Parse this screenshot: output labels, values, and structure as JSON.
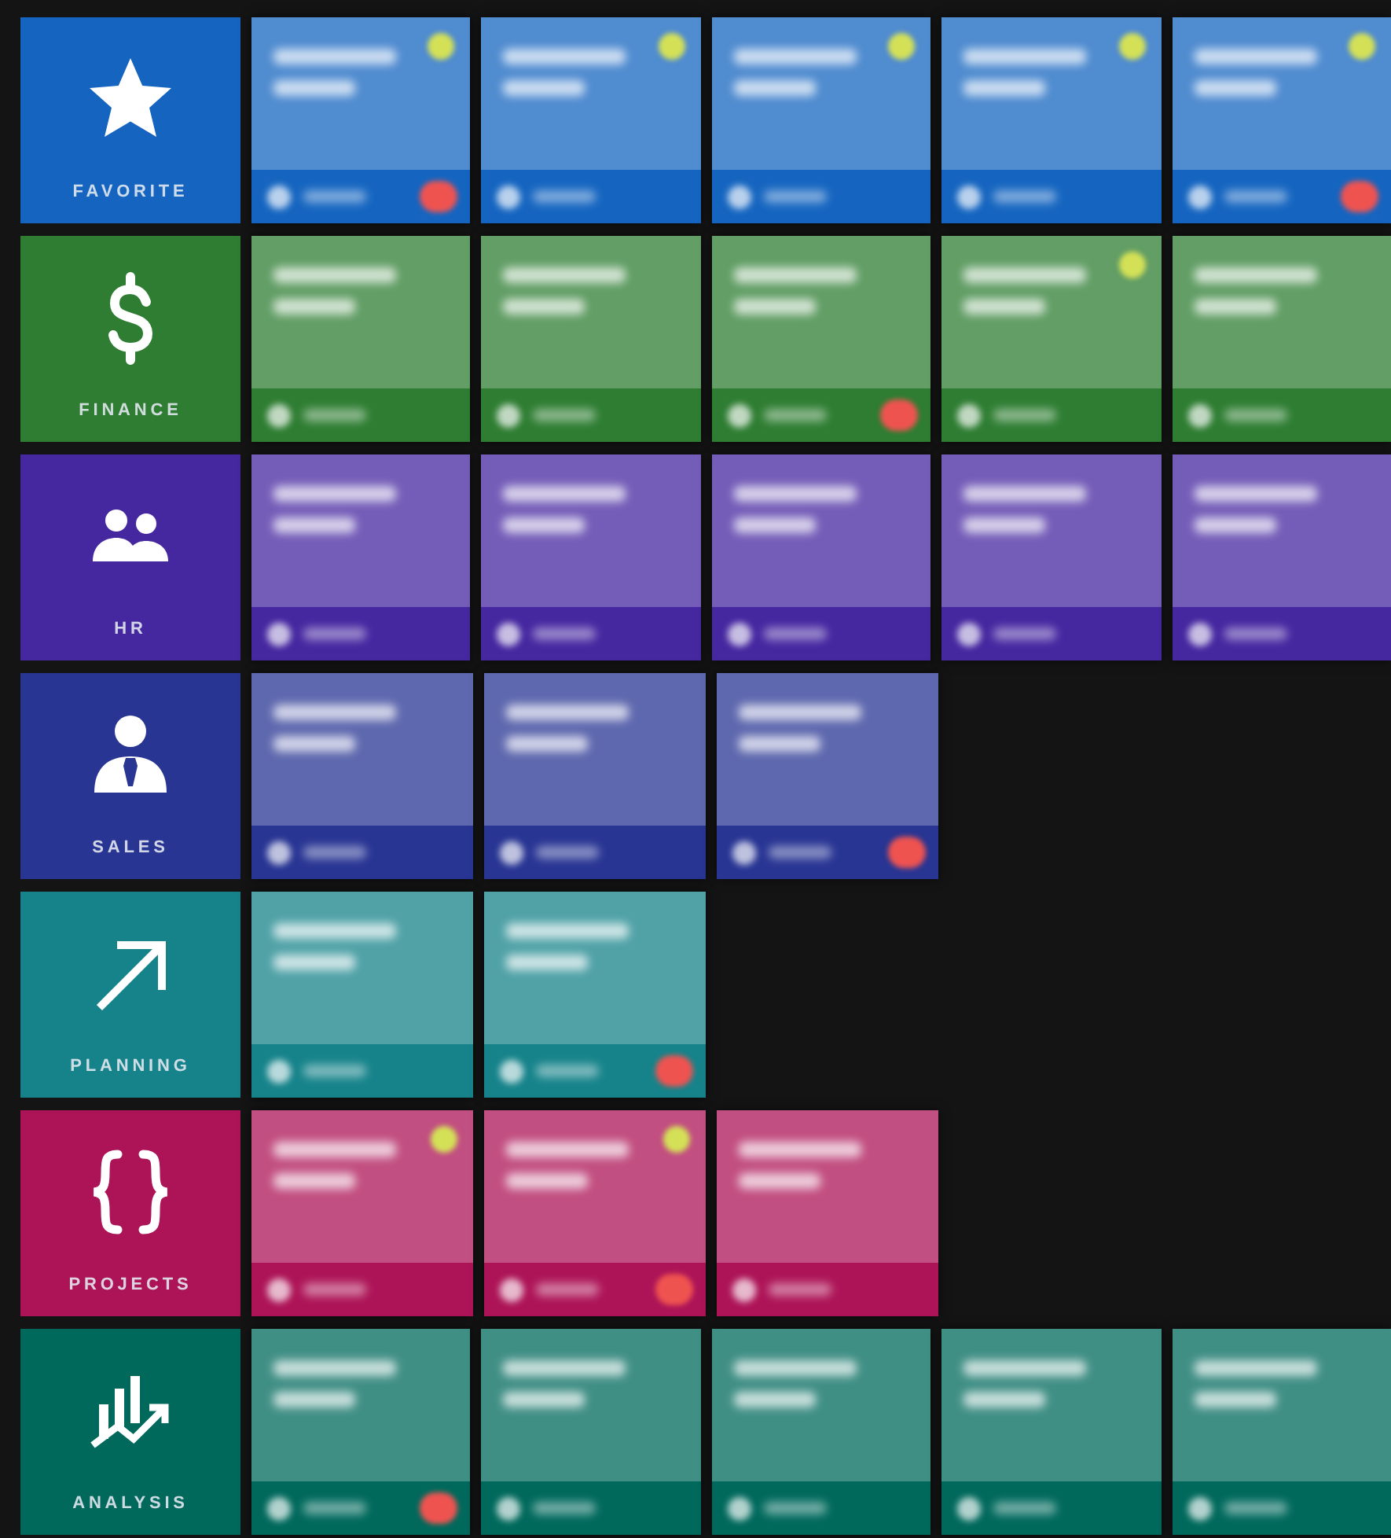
{
  "categories": [
    {
      "label": "FAVORITE",
      "kind": "star",
      "color": "#1565c0",
      "tiles": [
        {
          "starred": true,
          "badge": true
        },
        {
          "starred": true,
          "badge": false
        },
        {
          "starred": true,
          "badge": false
        },
        {
          "starred": true,
          "badge": false
        },
        {
          "starred": true,
          "badge": true
        }
      ]
    },
    {
      "label": "FINANCE",
      "kind": "dollar",
      "color": "#2e7d32",
      "tiles": [
        {
          "starred": false,
          "badge": false
        },
        {
          "starred": false,
          "badge": false
        },
        {
          "starred": false,
          "badge": true
        },
        {
          "starred": true,
          "badge": false
        },
        {
          "starred": false,
          "badge": false
        }
      ]
    },
    {
      "label": "HR",
      "kind": "people",
      "color": "#4527a0",
      "tiles": [
        {
          "starred": false,
          "badge": false
        },
        {
          "starred": false,
          "badge": false
        },
        {
          "starred": false,
          "badge": false
        },
        {
          "starred": false,
          "badge": false
        },
        {
          "starred": false,
          "badge": false
        }
      ]
    },
    {
      "label": "SALES",
      "kind": "person",
      "color": "#283593",
      "tiles": [
        {
          "starred": false,
          "badge": false
        },
        {
          "starred": false,
          "badge": false
        },
        {
          "starred": false,
          "badge": true
        }
      ]
    },
    {
      "label": "PLANNING",
      "kind": "arrow",
      "color": "#16838a",
      "tiles": [
        {
          "starred": false,
          "badge": false
        },
        {
          "starred": false,
          "badge": true
        }
      ]
    },
    {
      "label": "PROJECTS",
      "kind": "braces",
      "color": "#ad1457",
      "tiles": [
        {
          "starred": true,
          "badge": false
        },
        {
          "starred": true,
          "badge": true
        },
        {
          "starred": false,
          "badge": false
        }
      ]
    },
    {
      "label": "ANALYSIS",
      "kind": "chart",
      "color": "#00695c",
      "tiles": [
        {
          "starred": false,
          "badge": true
        },
        {
          "starred": false,
          "badge": false
        },
        {
          "starred": false,
          "badge": false
        },
        {
          "starred": false,
          "badge": false
        },
        {
          "starred": false,
          "badge": false
        }
      ]
    }
  ]
}
